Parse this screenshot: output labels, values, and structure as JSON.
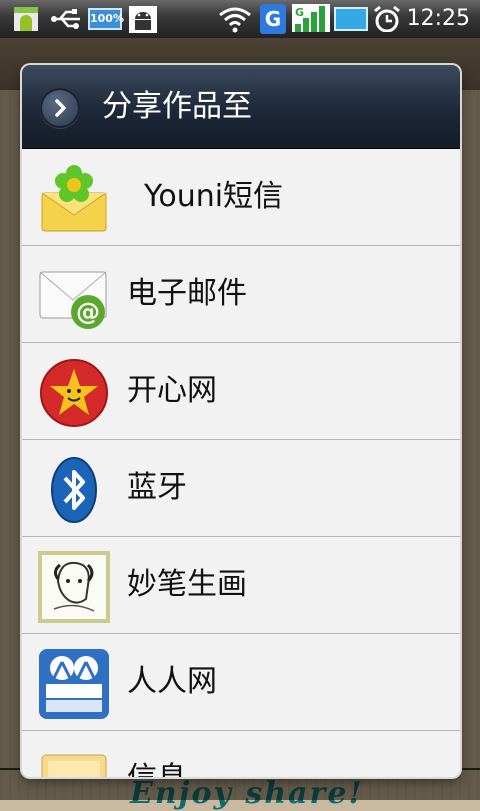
{
  "status_bar": {
    "time": "12:25",
    "battery_percent_label": "100%",
    "network_type": "G",
    "icons": [
      "android-notification-icon",
      "usb-icon",
      "battery-100-icon",
      "debug-android-icon",
      "wifi-icon",
      "g-network-icon",
      "signal-icon",
      "battery-icon",
      "alarm-icon"
    ]
  },
  "dialog": {
    "title": "分享作品至",
    "items": [
      {
        "label": "Youni短信",
        "icon": "envelope-flower-icon"
      },
      {
        "label": "电子邮件",
        "icon": "email-at-icon"
      },
      {
        "label": "开心网",
        "icon": "kaixin-star-icon"
      },
      {
        "label": "蓝牙",
        "icon": "bluetooth-icon"
      },
      {
        "label": "妙笔生画",
        "icon": "sketch-portrait-icon"
      },
      {
        "label": "人人网",
        "icon": "renren-icon"
      },
      {
        "label": "信息",
        "icon": "message-icon"
      }
    ]
  },
  "background": {
    "footer_text": "Enjoy share!"
  },
  "colors": {
    "header_dark": "#1d2838",
    "list_bg": "#f2f2f2",
    "divider": "#b6b6b6",
    "footer_text": "#136a6a"
  }
}
